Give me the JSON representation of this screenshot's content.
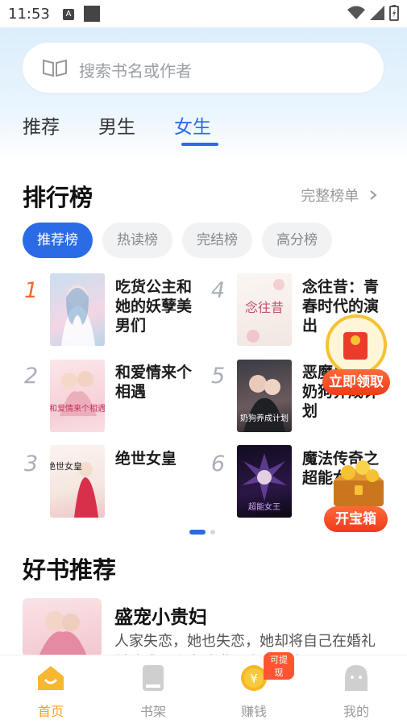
{
  "status_bar": {
    "time": "11:53",
    "notification_letter": "A"
  },
  "search": {
    "placeholder": "搜索书名或作者"
  },
  "tabs": [
    {
      "label": "推荐",
      "active": false
    },
    {
      "label": "男生",
      "active": false
    },
    {
      "label": "女生",
      "active": true
    }
  ],
  "ranking": {
    "title": "排行榜",
    "full_list_label": "完整榜单",
    "chips": [
      {
        "label": "推荐榜",
        "active": true
      },
      {
        "label": "热读榜",
        "active": false
      },
      {
        "label": "完结榜",
        "active": false
      },
      {
        "label": "高分榜",
        "active": false
      }
    ],
    "books": [
      {
        "rank": "1",
        "title": "吃货公主和她的妖孽美男们"
      },
      {
        "rank": "2",
        "title": "和爱情来个相遇"
      },
      {
        "rank": "3",
        "title": "绝世女皇"
      },
      {
        "rank": "4",
        "title": "念往昔：青春时代的演出"
      },
      {
        "rank": "5",
        "title": "恶魔总裁：奶狗养成计划"
      },
      {
        "rank": "6",
        "title": "魔法传奇之超能女王"
      }
    ],
    "cover_texts": {
      "c2": "和爱情来个相遇",
      "c3": "绝世女皇",
      "c4": "念往昔",
      "c5": "奶狗养成计划",
      "c6": "超能女王"
    }
  },
  "floating": {
    "redpacket_label": "立即领取",
    "chest_label": "开宝箱"
  },
  "recommend": {
    "title": "好书推荐",
    "book_title": "盛宠小贵妇",
    "description": "人家失恋，她也失恋，她却将自己在婚礼前改成了个大胖猫，这个婚礼"
  },
  "bottom_nav": [
    {
      "label": "首页",
      "icon": "home-icon",
      "active": true
    },
    {
      "label": "书架",
      "icon": "bookshelf-icon",
      "active": false
    },
    {
      "label": "赚钱",
      "icon": "coin-icon",
      "active": false,
      "badge": "可提现"
    },
    {
      "label": "我的",
      "icon": "profile-icon",
      "active": false
    }
  ],
  "colors": {
    "accent": "#2b6be6",
    "nav_active": "#f2a31b",
    "rank_first": "#f06a2c",
    "float_button": "#ee3b1c"
  }
}
